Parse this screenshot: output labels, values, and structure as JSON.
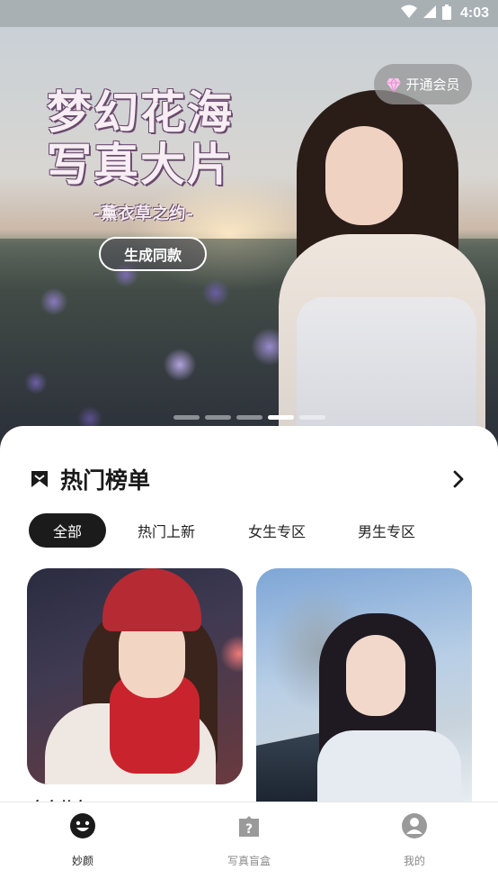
{
  "status_bar": {
    "time": "4:03",
    "icons": [
      "wifi-icon",
      "signal-icon",
      "battery-icon"
    ]
  },
  "banner": {
    "title_line1": "梦幻花海",
    "title_line2": "写真大片",
    "subtitle": "-薰衣草之约-",
    "generate_button": "生成同款",
    "vip_button": "开通会员",
    "carousel_count": 5,
    "carousel_active_index": 3
  },
  "hot_list": {
    "title": "热门榜单",
    "tabs": [
      {
        "label": "全部",
        "active": true
      },
      {
        "label": "热门上新",
        "active": false
      },
      {
        "label": "女生专区",
        "active": false
      },
      {
        "label": "男生专区",
        "active": false
      }
    ],
    "card_caption_partial": "白白共白"
  },
  "bottom_nav": [
    {
      "label": "妙颜",
      "icon": "smile-face-icon",
      "active": true
    },
    {
      "label": "写真盲盒",
      "icon": "mystery-box-icon",
      "active": false
    },
    {
      "label": "我的",
      "icon": "user-profile-icon",
      "active": false
    }
  ],
  "colors": {
    "status_bar": "#a9b0b4",
    "active_tab": "#1b1b1b",
    "nav_active": "#222222",
    "nav_inactive": "#8a8a8a",
    "vip_button_bg": "#969696"
  }
}
